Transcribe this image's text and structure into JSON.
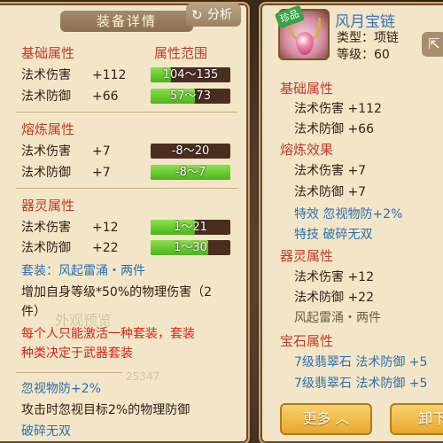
{
  "left": {
    "title": "装备详情",
    "analyze_label": "分析",
    "base_attr_title": "基础属性",
    "range_title": "属性范围",
    "base_attrs": [
      {
        "name": "法术伤害",
        "value": "+112",
        "range": "104～135",
        "fill": 0.25
      },
      {
        "name": "法术防御",
        "value": "+66",
        "range": "57～73",
        "fill": 0.56
      }
    ],
    "refine_title": "熔炼属性",
    "refine_attrs": [
      {
        "name": "法术伤害",
        "value": "+7",
        "range": "-8～20",
        "fill": 0.0
      },
      {
        "name": "法术防御",
        "value": "+7",
        "range": "-8～7",
        "fill": 1.0
      }
    ],
    "spirit_title": "器灵属性",
    "spirit_attrs": [
      {
        "name": "法术伤害",
        "value": "+12",
        "range": "1～21",
        "fill": 0.55
      },
      {
        "name": "法术防御",
        "value": "+22",
        "range": "1～30",
        "fill": 0.72
      }
    ],
    "set_label": "套装：风起雷涌・两件",
    "set_desc_1": "增加自身等级*50%的物理伤害（2",
    "set_desc_2": "件）",
    "red_line_1": "每个人只能激活一种套装，套装",
    "red_line_2": "种类决定于武器套装",
    "ignore_title": "忽视物防+2%",
    "ignore_desc": "攻击时忽视目标2%的物理防御",
    "break_title": "破碎无双",
    "ghost_1": "外观预览",
    "ghost_2": "25347"
  },
  "right": {
    "badge": "珍品",
    "item_name": "风月宝链",
    "type_label": "类型：项链",
    "level_label": "等级：60",
    "base_title": "基础属性",
    "base_lines": [
      "法术伤害 +112",
      "法术防御 +66"
    ],
    "refine_title": "熔炼效果",
    "refine_lines": [
      "法术伤害 +7",
      "法术防御 +7"
    ],
    "special_effect": "特效  忽视物防+2%",
    "special_skill": "特技  破碎无双",
    "spirit_title": "器灵属性",
    "spirit_lines": [
      "法术伤害 +12",
      "法术防御 +22"
    ],
    "set_line": "风起雷涌・两件",
    "gem_title": "宝石属性",
    "gem_lines": [
      "7级翡翠石  法术防御  +5",
      "7级翡翠石  法术防御  +5"
    ],
    "more_label": "更多",
    "unequip_label": "卸下"
  },
  "colors": {
    "section_red": "#c0392b",
    "blue": "#2a6fb0",
    "bar_fill": "#4ab51e",
    "button_gold": "#e9a72e"
  }
}
